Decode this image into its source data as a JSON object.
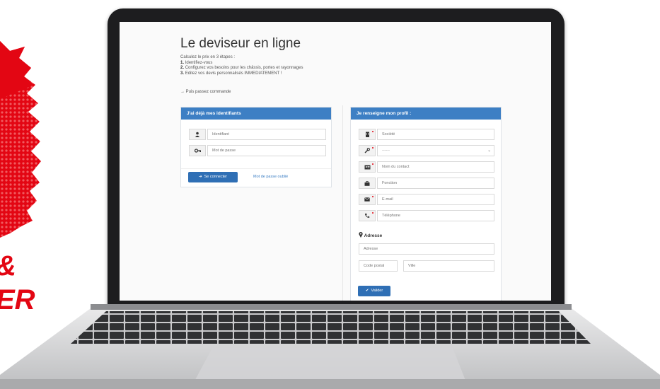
{
  "brand": {
    "accent_color": "#e30613",
    "fragment_1": "&",
    "fragment_2": "ER"
  },
  "page": {
    "title": "Le deviseur en ligne",
    "intro_line": "Calculez le prix en 3 étapes :",
    "steps": [
      {
        "num": "1.",
        "text": "Identifiez-vous"
      },
      {
        "num": "2.",
        "text": "Configurez vos besoins pour les châssis, portes et rayonnages"
      },
      {
        "num": "3.",
        "text": "Editez vos devis personnalisés IMMEDIATEMENT !"
      }
    ],
    "then_order": "→ Puis passez commande"
  },
  "login_panel": {
    "header": "J'ai déjà mes identifiants",
    "username_placeholder": "Identifiant",
    "password_placeholder": "Mot de passe",
    "login_button": "Se connecter",
    "forgot_link": "Mot de passe oublié",
    "icons": [
      "user-icon",
      "key-icon",
      "sign-in-icon"
    ]
  },
  "profile_panel": {
    "header": "Je renseigne mon profil :",
    "company_placeholder": "Société",
    "type_selected": "------",
    "contact_placeholder": "Nom du contact",
    "function_placeholder": "Fonction",
    "email_placeholder": "E-mail",
    "phone_placeholder": "Téléphone",
    "address_label": "Adresse",
    "address_placeholder": "Adresse",
    "postcode_placeholder": "Code postal",
    "city_placeholder": "Ville",
    "submit_button": "Valider",
    "icons": [
      "building-icon",
      "wrench-icon",
      "contact-card-icon",
      "briefcase-icon",
      "envelope-icon",
      "phone-icon",
      "map-marker-icon",
      "check-icon"
    ]
  }
}
